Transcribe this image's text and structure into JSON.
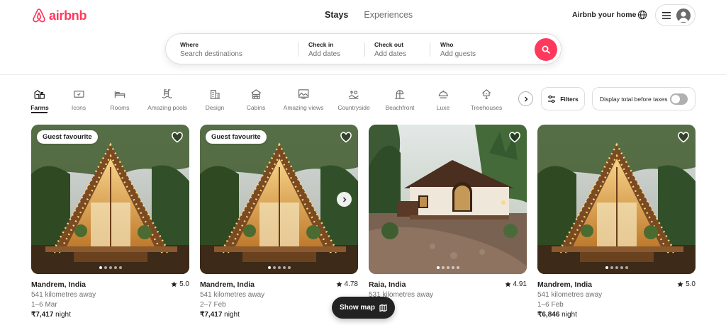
{
  "header": {
    "logo_text": "airbnb",
    "tabs": [
      {
        "label": "Stays",
        "active": true
      },
      {
        "label": "Experiences",
        "active": false
      }
    ],
    "host_link": "Airbnb your home",
    "icons": {
      "globe": "globe-icon",
      "menu": "hamburger-menu-icon",
      "avatar": "user-avatar-icon"
    }
  },
  "search": {
    "where": {
      "label": "Where",
      "placeholder": "Search destinations"
    },
    "checkin": {
      "label": "Check in",
      "placeholder": "Add dates"
    },
    "checkout": {
      "label": "Check out",
      "placeholder": "Add dates"
    },
    "who": {
      "label": "Who",
      "placeholder": "Add guests"
    },
    "button_icon": "search-icon"
  },
  "categories": [
    {
      "label": "Farms",
      "icon": "farm-icon",
      "active": true
    },
    {
      "label": "Icons",
      "icon": "icons-ticket-icon",
      "active": false
    },
    {
      "label": "Rooms",
      "icon": "bed-icon",
      "active": false
    },
    {
      "label": "Amazing pools",
      "icon": "pool-icon",
      "active": false
    },
    {
      "label": "Design",
      "icon": "design-building-icon",
      "active": false
    },
    {
      "label": "Cabins",
      "icon": "cabin-icon",
      "active": false
    },
    {
      "label": "Amazing views",
      "icon": "view-frame-icon",
      "active": false
    },
    {
      "label": "Countryside",
      "icon": "countryside-icon",
      "active": false
    },
    {
      "label": "Beachfront",
      "icon": "beach-icon",
      "active": false
    },
    {
      "label": "Luxe",
      "icon": "luxe-icon",
      "active": false
    },
    {
      "label": "Treehouses",
      "icon": "treehouse-icon",
      "active": false
    }
  ],
  "filters": {
    "label": "Filters",
    "icon": "sliders-icon"
  },
  "taxes": {
    "label": "Display total before taxes",
    "enabled": false
  },
  "listings": [
    {
      "badge": "Guest favourite",
      "location": "Mandrem, India",
      "rating": "5.0",
      "distance": "541 kilometres away",
      "dates": "1–6 Mar",
      "price": "₹7,417",
      "price_unit": "night",
      "scene": "aframe"
    },
    {
      "badge": "Guest favourite",
      "location": "Mandrem, India",
      "rating": "4.78",
      "distance": "541 kilometres away",
      "dates": "2–7 Feb",
      "price": "₹7,417",
      "price_unit": "night",
      "scene": "aframe"
    },
    {
      "badge": "",
      "location": "Raia, India",
      "rating": "4.91",
      "distance": "531 kilometres away",
      "dates": "",
      "price": "",
      "price_unit": "",
      "scene": "cottage"
    },
    {
      "badge": "",
      "location": "Mandrem, India",
      "rating": "5.0",
      "distance": "541 kilometres away",
      "dates": "1–6 Feb",
      "price": "₹6,846",
      "price_unit": "night",
      "scene": "aframe"
    }
  ],
  "map_button": {
    "label": "Show map",
    "icon": "map-icon"
  },
  "colors": {
    "brand": "#ff385c",
    "text": "#222222",
    "muted": "#717171",
    "border": "#dddddd"
  }
}
